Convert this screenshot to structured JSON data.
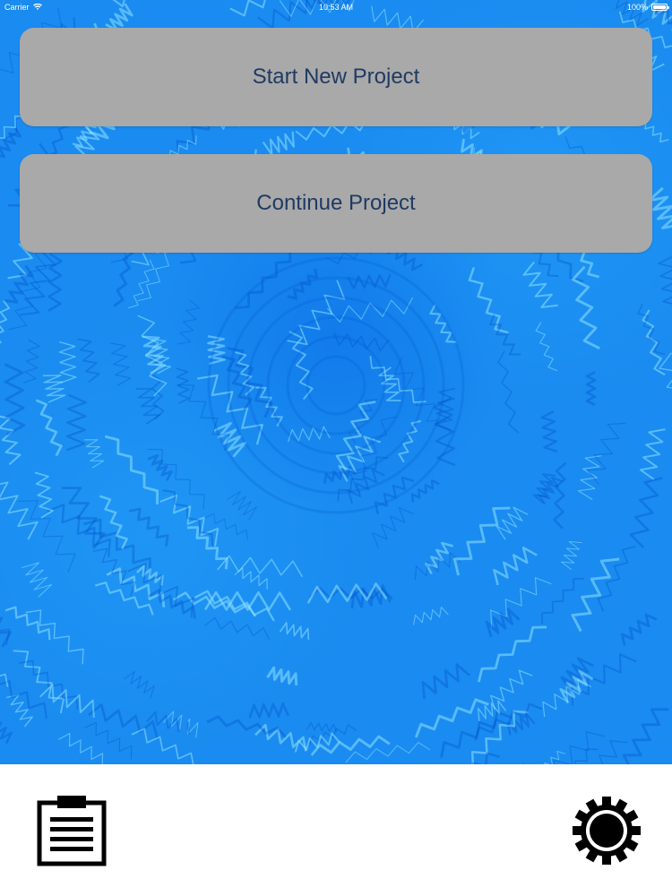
{
  "status_bar": {
    "carrier": "Carrier",
    "time": "10:53 AM",
    "battery_percent": "100%",
    "battery_level": 1.0
  },
  "menu": {
    "start_new_label": "Start New Project",
    "continue_label": "Continue Project"
  },
  "toolbar": {
    "left_icon": "clipboard-icon",
    "right_icon": "gear-icon"
  },
  "colors": {
    "background_water": "#1a8bf0",
    "button_fill": "#a9a9a9",
    "button_text": "#1f3a63",
    "toolbar_bg": "#ffffff",
    "icon_color": "#000000"
  }
}
